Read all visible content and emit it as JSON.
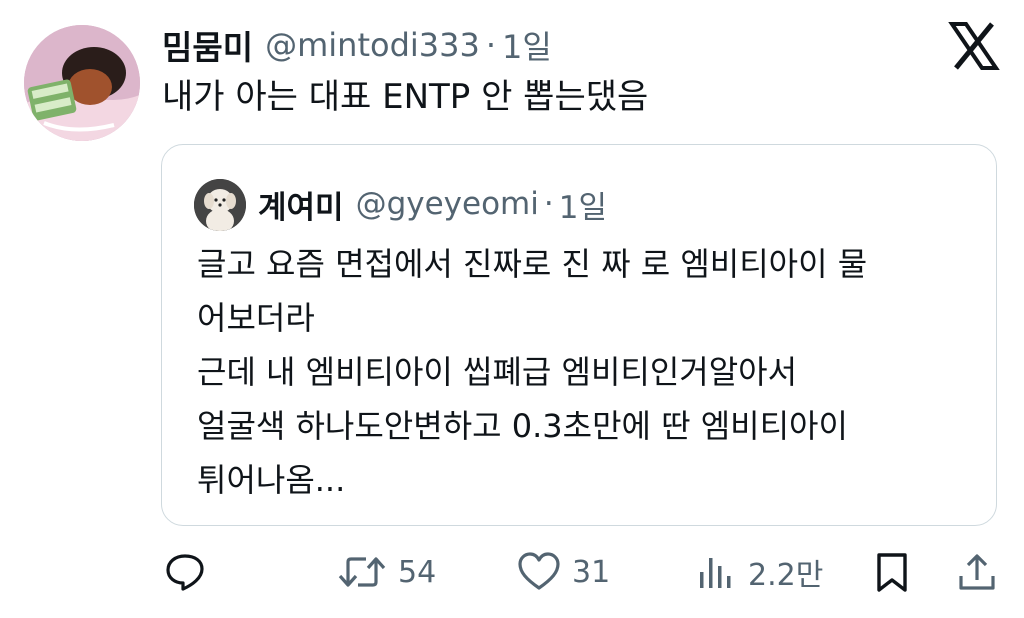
{
  "tweet": {
    "author_name": "밈뭄미",
    "author_handle": "@mintodi333",
    "separator": "·",
    "time": "1일",
    "text": "내가 아는 대표 ENTP 안 뽑는댔음"
  },
  "quoted": {
    "author_name": "계여미",
    "author_handle": "@gyeyeomi",
    "separator": "·",
    "time": "1일",
    "lines": [
      "글고 요즘 면접에서 진짜로 진 짜 로 엠비티아이 물",
      "어보더라",
      "근데 내 엠비티아이 씹폐급 엠비티인거알아서",
      "얼굴색 하나도안변하고 0.3초만에 딴 엠비티아이",
      "튀어나옴..."
    ]
  },
  "actions": {
    "reply_icon": "reply-icon",
    "retweet_icon": "retweet-icon",
    "retweet_count": "54",
    "like_icon": "heart-icon",
    "like_count": "31",
    "views_icon": "views-icon",
    "views_count": "2.2만",
    "bookmark_icon": "bookmark-icon",
    "share_icon": "share-icon"
  },
  "brand": {
    "logo": "x-logo-icon"
  },
  "colors": {
    "text": "#0f1419",
    "secondary": "#536471",
    "border": "#cfd9de"
  }
}
